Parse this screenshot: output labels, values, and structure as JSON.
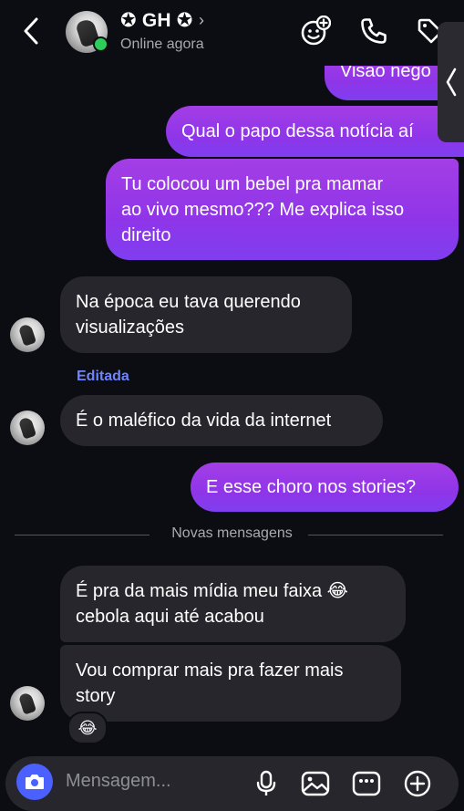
{
  "header": {
    "contact_name": "✪ GH ✪",
    "chevron": "›",
    "status": "Online agora",
    "icons": [
      "back-icon",
      "avatar-sticker-icon",
      "phone-icon",
      "tag-icon",
      "side-tab-chevron-icon"
    ]
  },
  "messages": [
    {
      "id": "m1",
      "direction": "out",
      "text": "Visão negó"
    },
    {
      "id": "m2",
      "direction": "out",
      "text": "Qual o papo dessa notícia aí"
    },
    {
      "id": "m3",
      "direction": "out",
      "text": "Tu colocou um bebel pra mamar\nao vivo mesmo??? Me explica isso\ndireito"
    },
    {
      "id": "m4",
      "direction": "in",
      "text": "Na época eu tava querendo\nvisualizações"
    },
    {
      "id": "m5",
      "direction": "in",
      "label": "Editada",
      "text": "É o maléfico da vida da internet"
    },
    {
      "id": "m6",
      "direction": "out",
      "text": "E esse choro nos stories?"
    },
    {
      "id": "m7",
      "direction": "in",
      "text": "É pra da mais mídia meu faixa 😂\ncebola aqui até acabou"
    },
    {
      "id": "m8",
      "direction": "in",
      "text": "Vou comprar mais pra fazer mais\nstory",
      "reaction": "😂"
    }
  ],
  "divider": {
    "label": "Novas mensagens"
  },
  "composer": {
    "placeholder": "Mensagem...",
    "icons": [
      "camera-icon",
      "microphone-icon",
      "gallery-icon",
      "sticker-icon",
      "add-icon"
    ]
  },
  "colors": {
    "background": "#0c0c13",
    "outgoing_bubble": "#9a3ae8",
    "incoming_bubble": "#26262c",
    "accent_blue": "#4a61ff",
    "edited_label": "#6f84ff",
    "online": "#2dcf5a"
  }
}
